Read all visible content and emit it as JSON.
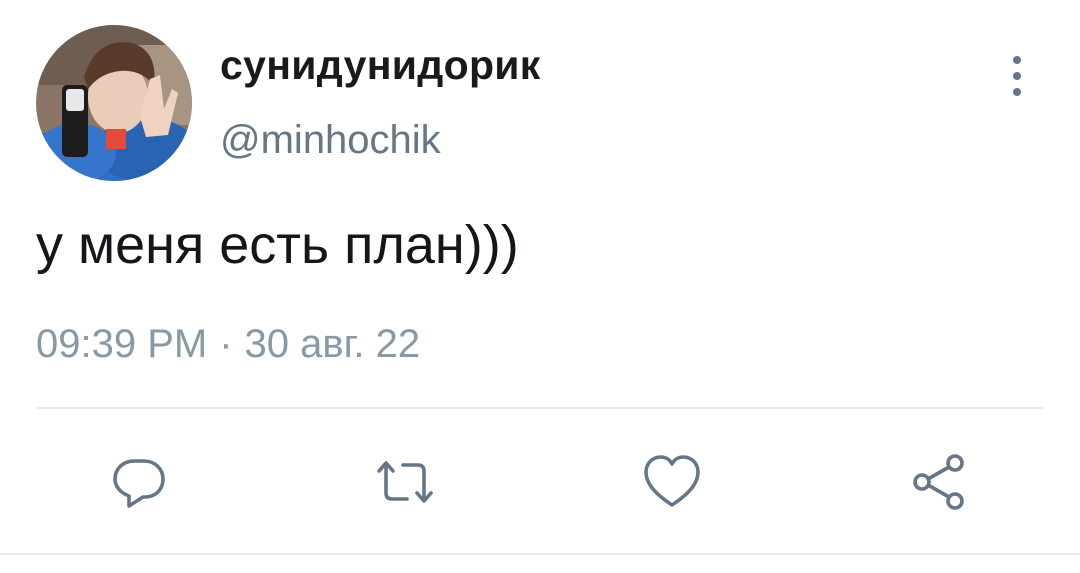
{
  "tweet": {
    "display_name": "сунидунидорик",
    "handle": "@minhochik",
    "text": "у меня есть план)))",
    "time": "09:39 PM",
    "separator": "·",
    "date": "30 авг. 22"
  },
  "actions": {
    "reply_icon": "reply-icon",
    "retweet_icon": "retweet-icon",
    "like_icon": "heart-icon",
    "share_icon": "share-icon"
  },
  "colors": {
    "text_primary": "#14171a",
    "text_secondary": "#657786",
    "icon": "#657786",
    "divider": "#e6ecf0"
  }
}
